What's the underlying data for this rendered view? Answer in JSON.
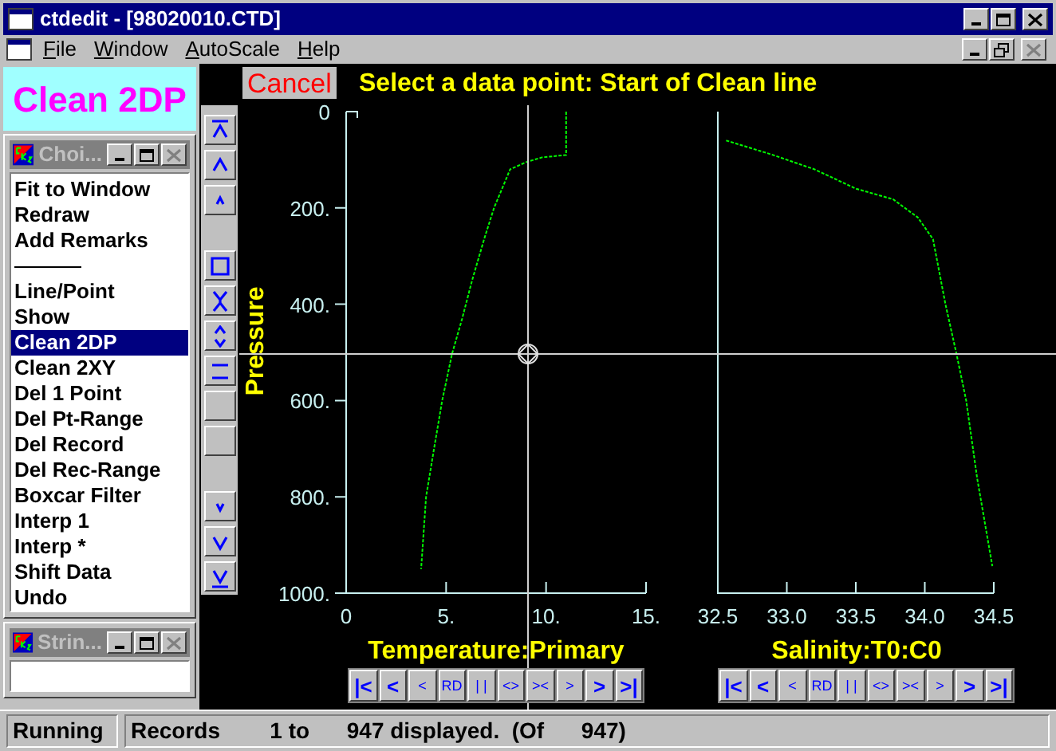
{
  "window": {
    "title": "ctdedit - [98020010.CTD]"
  },
  "menu": [
    "File",
    "Window",
    "AutoScale",
    "Help"
  ],
  "mode_label": "Clean 2DP",
  "choice_window": {
    "title": "Choi...",
    "items": [
      {
        "kind": "item",
        "label": "Fit to Window",
        "selected": false
      },
      {
        "kind": "item",
        "label": "Redraw",
        "selected": false
      },
      {
        "kind": "item",
        "label": "Add Remarks",
        "selected": false
      },
      {
        "kind": "separator"
      },
      {
        "kind": "item",
        "label": "Line/Point",
        "selected": false
      },
      {
        "kind": "item",
        "label": "Show",
        "selected": false
      },
      {
        "kind": "item",
        "label": "Clean 2DP",
        "selected": true
      },
      {
        "kind": "item",
        "label": "Clean 2XY",
        "selected": false
      },
      {
        "kind": "item",
        "label": "Del 1 Point",
        "selected": false
      },
      {
        "kind": "item",
        "label": "Del Pt-Range",
        "selected": false
      },
      {
        "kind": "item",
        "label": "Del Record",
        "selected": false
      },
      {
        "kind": "item",
        "label": "Del Rec-Range",
        "selected": false
      },
      {
        "kind": "item",
        "label": "Boxcar Filter",
        "selected": false
      },
      {
        "kind": "item",
        "label": "Interp 1",
        "selected": false
      },
      {
        "kind": "item",
        "label": "Interp *",
        "selected": false
      },
      {
        "kind": "item",
        "label": "Shift Data",
        "selected": false
      },
      {
        "kind": "item",
        "label": "Undo",
        "selected": false
      }
    ]
  },
  "string_window": {
    "title": "Strin..."
  },
  "cancel_button": "Cancel",
  "prompt": "Select a data point: Start of Clean line",
  "charts": [
    {
      "chart_data": {
        "type": "line",
        "orientation": "horizontal",
        "ylabel": "Pressure",
        "xlim": [
          0,
          15
        ],
        "ylim": [
          1000,
          0
        ],
        "xticks": [
          {
            "value": 0,
            "label": "0"
          },
          {
            "value": 5,
            "label": "5."
          },
          {
            "value": 10,
            "label": "10."
          },
          {
            "value": 15,
            "label": "15."
          }
        ],
        "yticks": [
          {
            "value": 0,
            "label": "0"
          },
          {
            "value": 200,
            "label": "200."
          },
          {
            "value": 400,
            "label": "400."
          },
          {
            "value": 600,
            "label": "600."
          },
          {
            "value": 800,
            "label": "800."
          },
          {
            "value": 1000,
            "label": "1000."
          }
        ],
        "x": [
          0,
          90,
          95,
          105,
          120,
          200,
          265,
          350,
          430,
          503,
          600,
          700,
          800,
          950
        ],
        "series": [
          {
            "name": "Temperature:Primary",
            "color": "#00ff00",
            "line_style": "dotted",
            "values": [
              11.0,
              11.0,
              9.8,
              9.0,
              8.2,
              7.4,
              6.9,
              6.3,
              5.8,
              5.3,
              4.8,
              4.4,
              4.0,
              3.75
            ]
          }
        ]
      },
      "nav_buttons": [
        {
          "label": "|<",
          "kind": "large"
        },
        {
          "label": "<",
          "kind": "large"
        },
        {
          "label": "<",
          "kind": "small"
        },
        {
          "label": "RD",
          "kind": "small"
        },
        {
          "label": "| |",
          "kind": "small"
        },
        {
          "label": "<>",
          "kind": "small"
        },
        {
          "label": "><",
          "kind": "small"
        },
        {
          "label": ">",
          "kind": "small"
        },
        {
          "label": ">",
          "kind": "large"
        },
        {
          "label": ">|",
          "kind": "large"
        }
      ]
    },
    {
      "chart_data": {
        "type": "line",
        "orientation": "horizontal",
        "xlim": [
          32.5,
          34.5
        ],
        "ylim": [
          1000,
          0
        ],
        "xticks": [
          {
            "value": 32.5,
            "label": "32.5"
          },
          {
            "value": 33.0,
            "label": "33.0"
          },
          {
            "value": 33.5,
            "label": "33.5"
          },
          {
            "value": 34.0,
            "label": "34.0"
          },
          {
            "value": 34.5,
            "label": "34.5"
          }
        ],
        "x": [
          60,
          90,
          120,
          160,
          182,
          220,
          265,
          400,
          503,
          600,
          762,
          944
        ],
        "series": [
          {
            "name": "Salinity:T0:C0",
            "color": "#00ff00",
            "line_style": "dotted",
            "values": [
              32.56,
              32.9,
              33.2,
              33.5,
              33.77,
              33.95,
              34.06,
              34.15,
              34.23,
              34.3,
              34.38,
              34.49
            ]
          }
        ]
      },
      "nav_buttons": [
        {
          "label": "|<",
          "kind": "large"
        },
        {
          "label": "<",
          "kind": "large"
        },
        {
          "label": "<",
          "kind": "small"
        },
        {
          "label": "RD",
          "kind": "small"
        },
        {
          "label": "| |",
          "kind": "small"
        },
        {
          "label": "<>",
          "kind": "small"
        },
        {
          "label": "><",
          "kind": "small"
        },
        {
          "label": ">",
          "kind": "small"
        },
        {
          "label": ">",
          "kind": "large"
        },
        {
          "label": ">|",
          "kind": "large"
        }
      ]
    }
  ],
  "status_bar": {
    "state": "Running",
    "records": "Records        1 to      947 displayed.  (Of      947)"
  }
}
